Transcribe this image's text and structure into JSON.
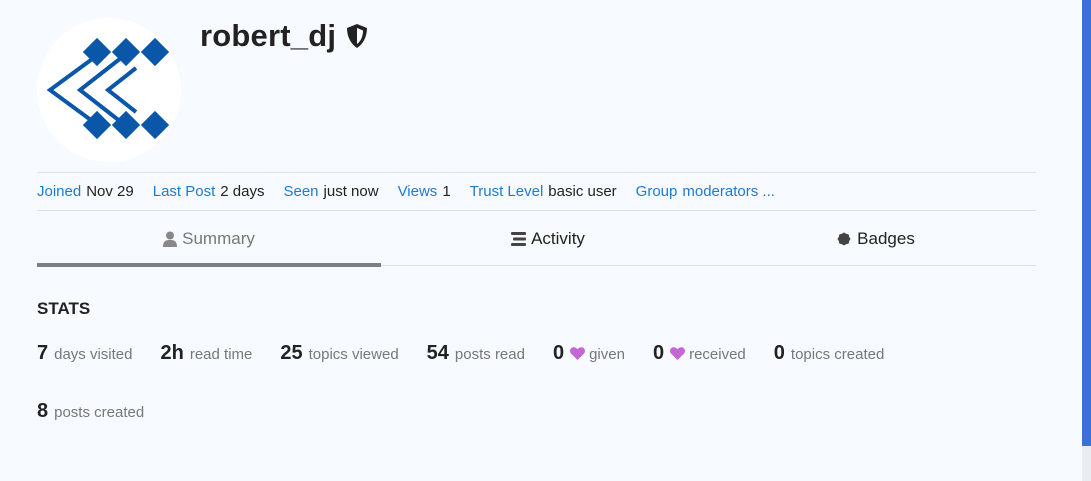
{
  "profile": {
    "username": "robert_dj",
    "avatar_icon": "chevron-logo-avatar",
    "moderator_icon": "shield-icon",
    "brand_color": "#0a56a8"
  },
  "meta": {
    "joined_label": "Joined",
    "joined_value": "Nov 29",
    "last_post_label": "Last Post",
    "last_post_value": "2 days",
    "seen_label": "Seen",
    "seen_value": "just now",
    "views_label": "Views",
    "views_value": "1",
    "trust_label": "Trust Level",
    "trust_value": "basic user",
    "group_label": "Group",
    "group_value": "moderators ..."
  },
  "tabs": [
    {
      "label": "Summary",
      "icon": "user-icon",
      "active": true
    },
    {
      "label": "Activity",
      "icon": "list-icon",
      "active": false
    },
    {
      "label": "Badges",
      "icon": "badge-icon",
      "active": false
    }
  ],
  "stats": {
    "title": "STATS",
    "items": [
      {
        "value": "7",
        "label": "days visited"
      },
      {
        "value": "2h",
        "label": "read time"
      },
      {
        "value": "25",
        "label": "topics viewed"
      },
      {
        "value": "54",
        "label": "posts read"
      },
      {
        "value": "0",
        "label": "given",
        "icon": "heart-icon"
      },
      {
        "value": "0",
        "label": "received",
        "icon": "heart-icon"
      },
      {
        "value": "0",
        "label": "topics created"
      },
      {
        "value": "8",
        "label": "posts created"
      }
    ],
    "heart_color": "#c367d5"
  },
  "colors": {
    "link": "#1f7ad1",
    "scrollbar_thumb": "#3a70d8"
  }
}
